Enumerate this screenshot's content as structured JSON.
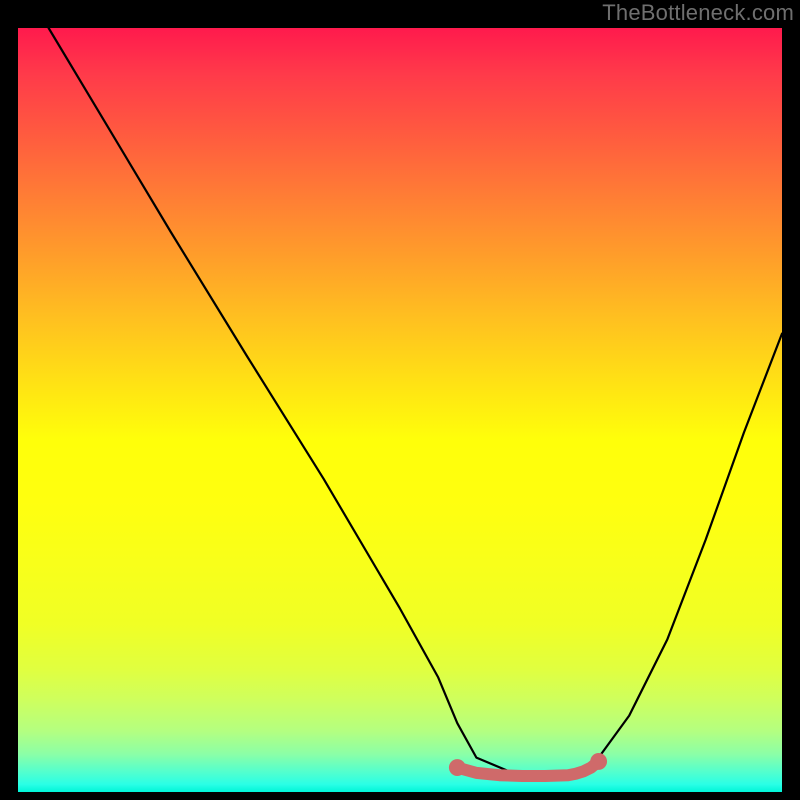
{
  "attribution": "TheBottleneck.com",
  "chart_data": {
    "type": "line",
    "title": "",
    "xlabel": "",
    "ylabel": "",
    "xlim": [
      0,
      100
    ],
    "ylim": [
      0,
      100
    ],
    "grid": false,
    "legend": false,
    "series": [
      {
        "name": "curve",
        "color": "#000000",
        "x": [
          4,
          10,
          20,
          30,
          40,
          50,
          55,
          57.5,
          60,
          65,
          70,
          73,
          76,
          80,
          85,
          90,
          95,
          100
        ],
        "y": [
          100,
          90,
          73.3,
          57,
          41,
          24,
          15,
          9,
          4.5,
          2.4,
          2.1,
          2.4,
          4.5,
          10,
          20,
          33,
          47,
          60
        ]
      },
      {
        "name": "optimal-band",
        "color": "#cf6a6a",
        "x": [
          57.5,
          60,
          63,
          66,
          69,
          72,
          73,
          74,
          75,
          76
        ],
        "y": [
          3.2,
          2.5,
          2.2,
          2.1,
          2.1,
          2.2,
          2.4,
          2.7,
          3.2,
          4.0
        ]
      }
    ],
    "markers": [
      {
        "name": "start-dot",
        "x": 57.5,
        "y": 3.2,
        "r": 1.1,
        "color": "#cf6a6a"
      },
      {
        "name": "end-dot",
        "x": 76,
        "y": 4.0,
        "r": 1.1,
        "color": "#cf6a6a"
      }
    ],
    "gradient_stops": [
      {
        "pct": 0,
        "color": "#ff1a4d"
      },
      {
        "pct": 50,
        "color": "#ffff0a"
      },
      {
        "pct": 90,
        "color": "#c0ff5a"
      },
      {
        "pct": 100,
        "color": "#00f5d8"
      }
    ]
  }
}
